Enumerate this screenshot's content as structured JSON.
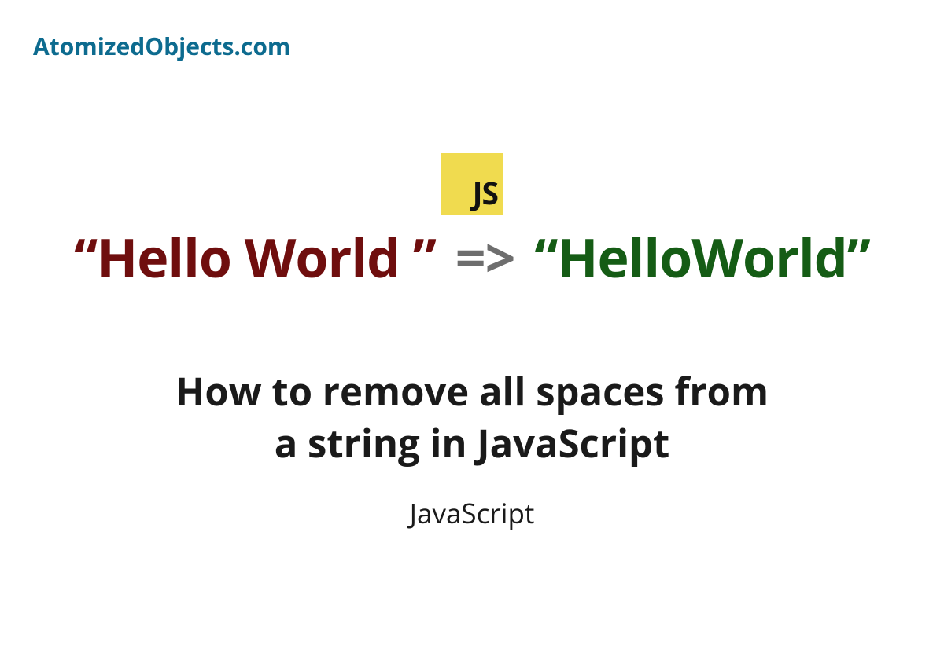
{
  "site": {
    "name": "AtomizedObjects.com"
  },
  "logo": {
    "label": "JS"
  },
  "code": {
    "before": "“Hello World ”",
    "arrow": "=>",
    "after": "“HelloWorld”"
  },
  "title": "How to remove all spaces from a string in JavaScript",
  "category": "JavaScript"
}
